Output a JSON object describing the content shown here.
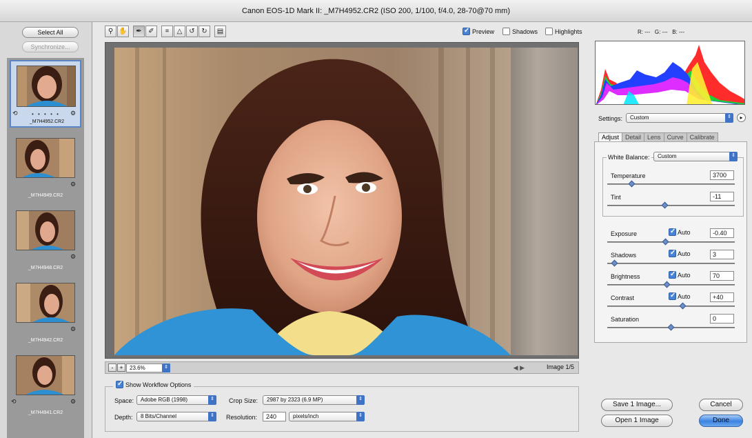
{
  "window": {
    "title": "Canon EOS-1D Mark II:  _M7H4952.CR2  (ISO 200, 1/100, f/4.0, 28-70@70 mm)"
  },
  "filmstrip": {
    "select_all": "Select All",
    "synchronize": "Synchronize...",
    "items": [
      {
        "label": "_M7H4952.CR2"
      },
      {
        "label": "_M7H4949.CR2"
      },
      {
        "label": "_M7H4948.CR2"
      },
      {
        "label": "_M7H4942.CR2"
      },
      {
        "label": "_M7H4941.CR2"
      }
    ],
    "rating_dots": "• • • • •"
  },
  "toolbar": {
    "tools": [
      "zoom-tool",
      "hand-tool",
      "white-balance-tool",
      "color-sampler-tool",
      "crop-tool",
      "straighten-tool",
      "rotate-left-tool",
      "rotate-right-tool",
      "delete-tool"
    ]
  },
  "view_options": {
    "preview": {
      "label": "Preview",
      "checked": true
    },
    "shadows": {
      "label": "Shadows",
      "checked": false
    },
    "highlights": {
      "label": "Highlights",
      "checked": false
    }
  },
  "readout": {
    "r": "R: ---",
    "g": "G: ---",
    "b": "B: ---"
  },
  "zoom": {
    "minus": "-",
    "plus": "+",
    "level": "23.6%",
    "image_count": "Image 1/5"
  },
  "workflow": {
    "show_label": "Show Workflow Options",
    "space_label": "Space:",
    "space_value": "Adobe RGB (1998)",
    "depth_label": "Depth:",
    "depth_value": "8 Bits/Channel",
    "crop_label": "Crop Size:",
    "crop_value": "2987 by 2323  (6.9 MP)",
    "resolution_label": "Resolution:",
    "resolution_value": "240",
    "resolution_unit": "pixels/inch"
  },
  "settings": {
    "label": "Settings:",
    "value": "Custom"
  },
  "tabs": [
    "Adjust",
    "Detail",
    "Lens",
    "Curve",
    "Calibrate"
  ],
  "adjust": {
    "white_balance_label": "White Balance:",
    "white_balance_value": "Custom",
    "auto_label": "Auto",
    "sliders": [
      {
        "label": "Temperature",
        "value": "3700",
        "level": 0.18,
        "auto": null
      },
      {
        "label": "Tint",
        "value": "-11",
        "level": 0.45,
        "auto": null
      },
      {
        "label": "Exposure",
        "value": "-0.40",
        "level": 0.46,
        "auto": true
      },
      {
        "label": "Shadows",
        "value": "3",
        "level": 0.04,
        "auto": true
      },
      {
        "label": "Brightness",
        "value": "70",
        "level": 0.47,
        "auto": true
      },
      {
        "label": "Contrast",
        "value": "+40",
        "level": 0.6,
        "auto": true
      },
      {
        "label": "Saturation",
        "value": "0",
        "level": 0.5,
        "auto": null
      }
    ]
  },
  "buttons": {
    "save": "Save 1 Image...",
    "open": "Open 1 Image",
    "cancel": "Cancel",
    "done": "Done"
  },
  "colors": {
    "accent": "#3b82e0",
    "selection": "#5a86c8"
  }
}
